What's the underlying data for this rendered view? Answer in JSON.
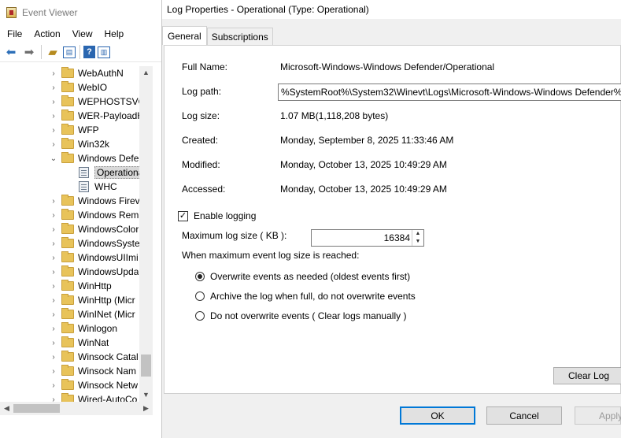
{
  "event_viewer": {
    "title": "Event Viewer",
    "menu": [
      "File",
      "Action",
      "View",
      "Help"
    ],
    "tree": [
      {
        "label": "WebAuthN",
        "expanded": false
      },
      {
        "label": "WebIO",
        "expanded": false
      },
      {
        "label": "WEPHOSTSVC",
        "expanded": false
      },
      {
        "label": "WER-PayloadH",
        "expanded": false
      },
      {
        "label": "WFP",
        "expanded": false
      },
      {
        "label": "Win32k",
        "expanded": false
      },
      {
        "label": "Windows Defe",
        "expanded": true
      },
      {
        "label": "Operationa",
        "child": true,
        "selected": true
      },
      {
        "label": "WHC",
        "child": true
      },
      {
        "label": "Windows Firev",
        "expanded": false
      },
      {
        "label": "Windows Rem",
        "expanded": false
      },
      {
        "label": "WindowsColor",
        "expanded": false
      },
      {
        "label": "WindowsSyste",
        "expanded": false
      },
      {
        "label": "WindowsUIImi",
        "expanded": false
      },
      {
        "label": "WindowsUpda",
        "expanded": false
      },
      {
        "label": "WinHttp",
        "expanded": false
      },
      {
        "label": "WinHttp (Micr",
        "expanded": false
      },
      {
        "label": "WinINet (Micr",
        "expanded": false
      },
      {
        "label": "Winlogon",
        "expanded": false
      },
      {
        "label": "WinNat",
        "expanded": false
      },
      {
        "label": "Winsock Catal",
        "expanded": false
      },
      {
        "label": "Winsock Nam",
        "expanded": false
      },
      {
        "label": "Winsock Netw",
        "expanded": false
      },
      {
        "label": "Wired-AutoCo",
        "expanded": false
      }
    ]
  },
  "dialog": {
    "title": "Log Properties - Operational (Type: Operational)",
    "tabs": [
      "General",
      "Subscriptions"
    ],
    "full_name_label": "Full Name:",
    "full_name": "Microsoft-Windows-Windows Defender/Operational",
    "log_path_label": "Log path:",
    "log_path": "%SystemRoot%\\System32\\Winevt\\Logs\\Microsoft-Windows-Windows Defender%",
    "log_size_label": "Log size:",
    "log_size": "1.07 MB(1,118,208 bytes)",
    "created_label": "Created:",
    "created": "Monday, September 8, 2025 11:33:46 AM",
    "modified_label": "Modified:",
    "modified": "Monday, October 13, 2025 10:49:29 AM",
    "accessed_label": "Accessed:",
    "accessed": "Monday, October 13, 2025 10:49:29 AM",
    "enable_logging_label": "Enable logging",
    "enable_logging_checked": true,
    "max_size_label": "Maximum log size ( KB ):",
    "max_size": "16384",
    "when_max_label": "When maximum event log size is reached:",
    "options": [
      "Overwrite events as needed (oldest events first)",
      "Archive the log when full, do not overwrite events",
      "Do not overwrite events ( Clear logs manually )"
    ],
    "selected_option": 0,
    "clear_log": "Clear Log",
    "ok": "OK",
    "cancel": "Cancel",
    "apply": "Apply"
  }
}
